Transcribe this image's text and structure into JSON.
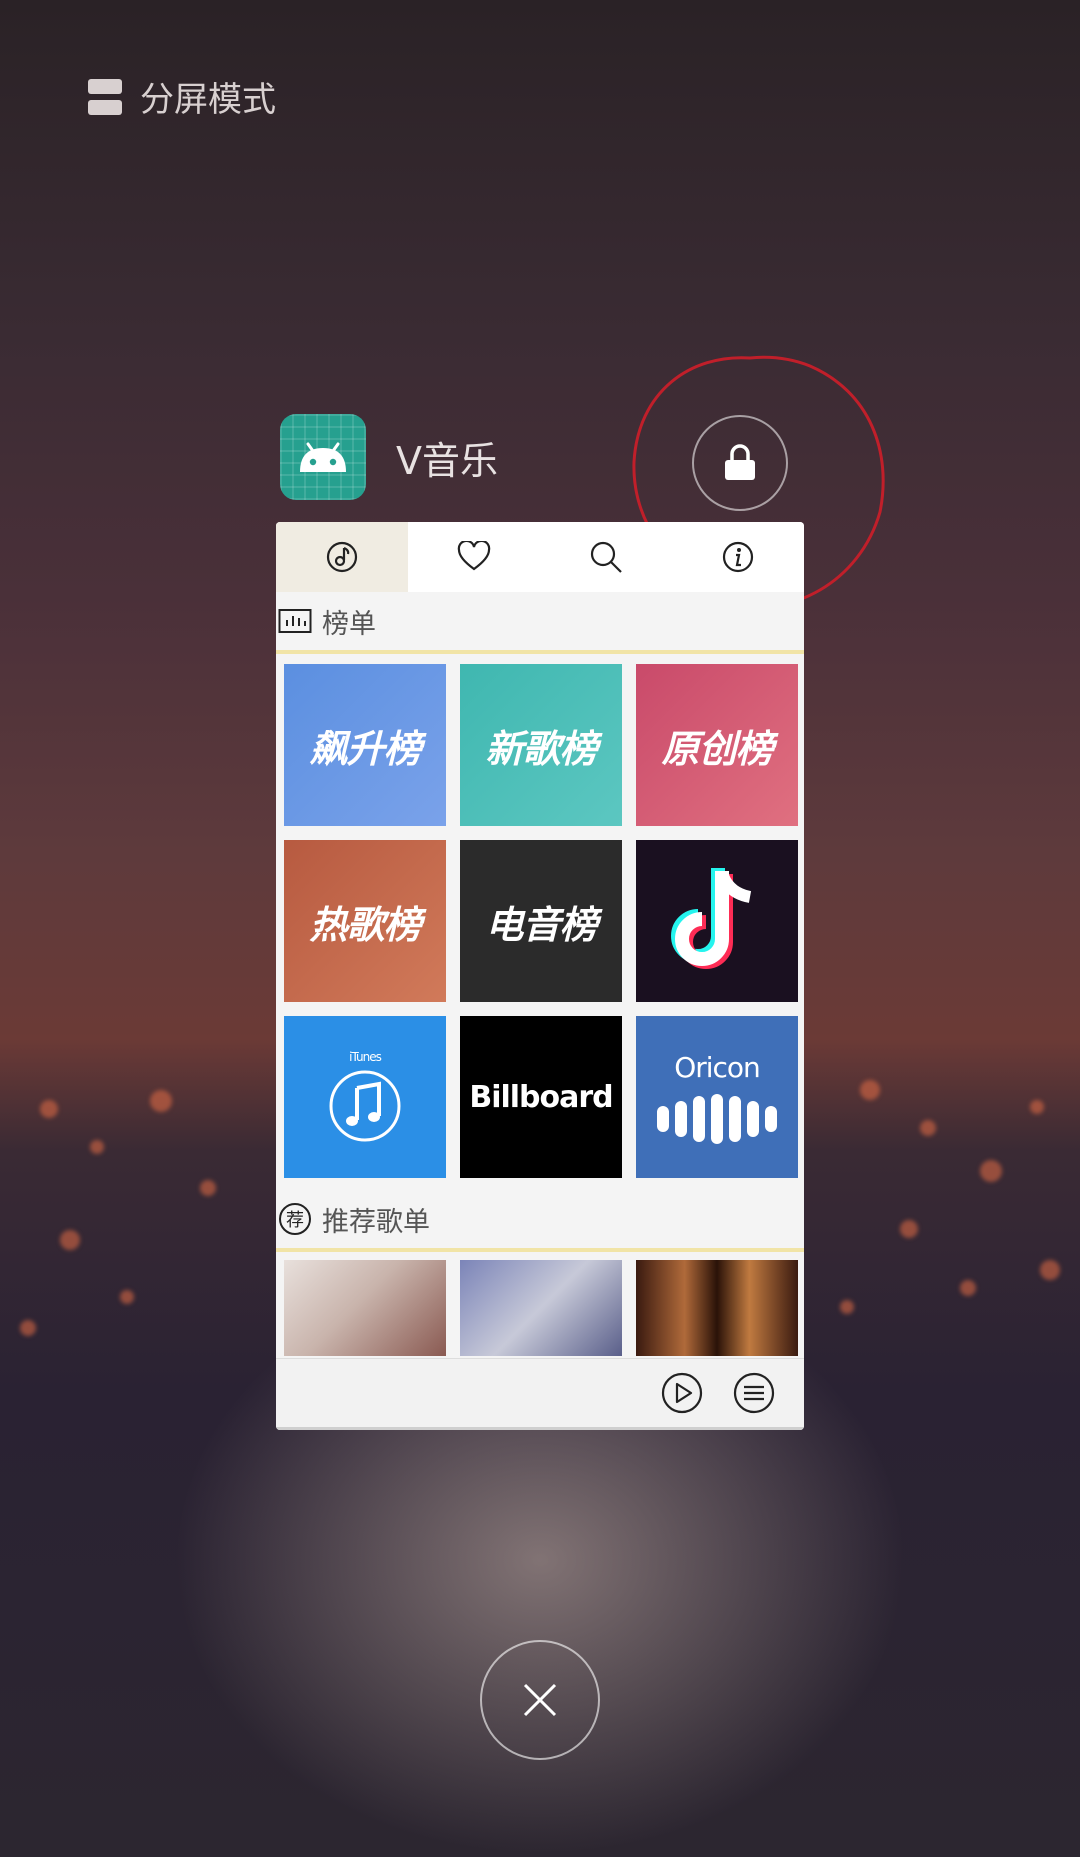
{
  "split_mode": {
    "label": "分屏模式",
    "icon": "split-screen-icon"
  },
  "app": {
    "name": "V音乐",
    "icon": "android-icon"
  },
  "lock": {
    "icon": "lock-icon"
  },
  "close": {
    "icon": "close-icon"
  },
  "card": {
    "tabs": [
      {
        "icon": "music-note-icon",
        "active": true
      },
      {
        "icon": "heart-icon",
        "active": false
      },
      {
        "icon": "search-icon",
        "active": false
      },
      {
        "icon": "info-icon",
        "active": false
      }
    ],
    "charts_section": {
      "label": "榜单",
      "tiles": [
        "飙升榜",
        "新歌榜",
        "原创榜",
        "热歌榜",
        "电音榜",
        "",
        "iTunes",
        "Billboard",
        "Oricon"
      ]
    },
    "recommend_section": {
      "label": "推荐歌单",
      "badge": "荐"
    },
    "bottom_bar": {
      "icons": [
        "play-icon",
        "menu-list-icon"
      ]
    }
  }
}
